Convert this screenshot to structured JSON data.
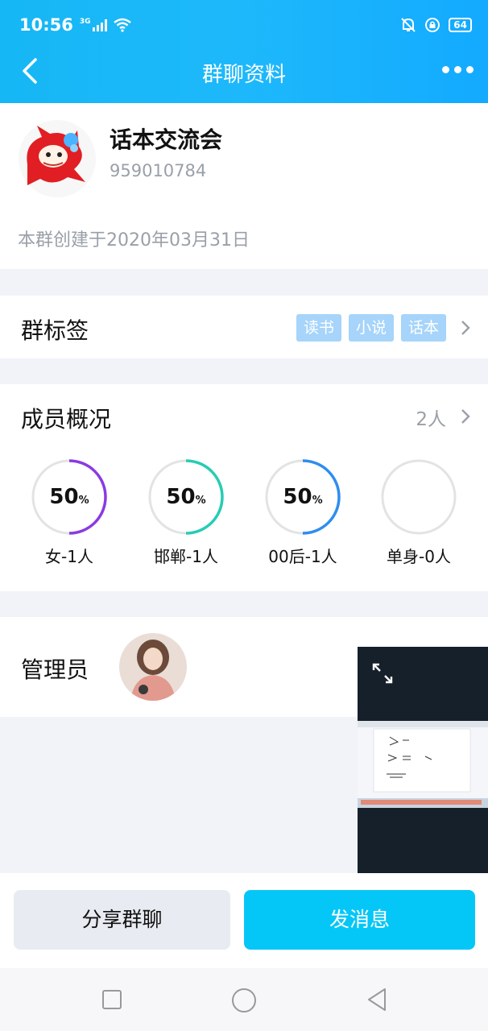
{
  "status_bar": {
    "time": "10:56",
    "network": "3G",
    "battery": "64"
  },
  "nav": {
    "title": "群聊资料"
  },
  "group": {
    "name": "话本交流会",
    "id": "959010784",
    "created": "本群创建于2020年03月31日"
  },
  "tags_section": {
    "label": "群标签",
    "tags": [
      "读书",
      "小说",
      "话本"
    ]
  },
  "members": {
    "label": "成员概况",
    "count": "2人",
    "stats": [
      {
        "value": "50",
        "unit": "%",
        "label": "女-1人",
        "color": "#8a3be0",
        "fraction": 0.5
      },
      {
        "value": "50",
        "unit": "%",
        "label": "邯郸-1人",
        "color": "#27ccb4",
        "fraction": 0.5
      },
      {
        "value": "50",
        "unit": "%",
        "label": "00后-1人",
        "color": "#2f8df0",
        "fraction": 0.5
      },
      {
        "value": "",
        "unit": "",
        "label": "单身-0人",
        "color": "#2f8df0",
        "fraction": 0
      }
    ]
  },
  "admin": {
    "label": "管理员"
  },
  "buttons": {
    "share": "分享群聊",
    "send": "发消息"
  },
  "colors": {
    "header": "#1db8fb",
    "accent": "#05c7f7",
    "tag": "#a6d4fa",
    "ring_track": "#e3e3e3"
  }
}
